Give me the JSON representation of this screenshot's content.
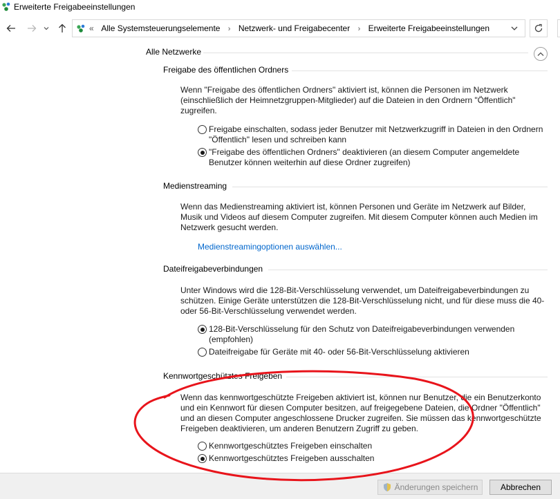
{
  "window": {
    "title": "Erweiterte Freigabeeinstellungen"
  },
  "nav": {
    "back_icon": "arrow-left",
    "forward_icon": "arrow-right",
    "recent_icon": "chevron-down",
    "up_icon": "arrow-up",
    "refresh_icon": "refresh"
  },
  "address": {
    "overflow": "«",
    "crumbs": [
      "Alle Systemsteuerungselemente",
      "Netzwerk- und Freigabecenter",
      "Erweiterte Freigabeeinstellungen"
    ],
    "separator": "›"
  },
  "group": {
    "title": "Alle Netzwerke"
  },
  "sections": {
    "public_folder": {
      "title": "Freigabe des öffentlichen Ordners",
      "description": "Wenn \"Freigabe des öffentlichen Ordners\" aktiviert ist, können die Personen im Netzwerk (einschließlich der Heimnetzgruppen-Mitglieder) auf die Dateien in den Ordnern \"Öffentlich\" zugreifen.",
      "options": [
        {
          "label": "Freigabe einschalten, sodass jeder Benutzer mit Netzwerkzugriff in Dateien in den Ordnern \"Öffentlich\" lesen und schreiben kann",
          "checked": false
        },
        {
          "label": "\"Freigabe des öffentlichen Ordners\" deaktivieren (an diesem Computer angemeldete Benutzer können weiterhin auf diese Ordner zugreifen)",
          "checked": true
        }
      ]
    },
    "media_streaming": {
      "title": "Medienstreaming",
      "description": "Wenn das Medienstreaming aktiviert ist, können Personen und Geräte im Netzwerk auf Bilder, Musik und Videos auf diesem Computer zugreifen. Mit diesem Computer können auch Medien im Netzwerk gesucht werden.",
      "link": "Medienstreamingoptionen auswählen..."
    },
    "file_sharing": {
      "title": "Dateifreigabeverbindungen",
      "description": "Unter Windows wird die 128-Bit-Verschlüsselung verwendet, um Dateifreigabeverbindungen zu schützen. Einige Geräte unterstützen die 128-Bit-Verschlüsselung nicht, und für diese muss die 40- oder 56-Bit-Verschlüsselung verwendet werden.",
      "options": [
        {
          "label": "128-Bit-Verschlüsselung für den Schutz von Dateifreigabeverbindungen verwenden (empfohlen)",
          "checked": true
        },
        {
          "label": "Dateifreigabe für Geräte mit 40- oder 56-Bit-Verschlüsselung aktivieren",
          "checked": false
        }
      ]
    },
    "password_sharing": {
      "title": "Kennwortgeschütztes Freigeben",
      "description": "Wenn das kennwortgeschützte Freigeben aktiviert ist, können nur Benutzer, die ein Benutzerkonto und ein Kennwort für diesen Computer besitzen, auf freigegebene Dateien, die Ordner \"Öffentlich\" und an diesen Computer angeschlossene Drucker zugreifen. Sie müssen das kennwortgeschützte Freigeben deaktivieren, um anderen Benutzern Zugriff zu geben.",
      "options": [
        {
          "label": "Kennwortgeschütztes Freigeben einschalten",
          "checked": false
        },
        {
          "label": "Kennwortgeschütztes Freigeben ausschalten",
          "checked": true
        }
      ]
    }
  },
  "footer": {
    "save_label": "Änderungen speichern",
    "cancel_label": "Abbrechen"
  },
  "colors": {
    "annotation": "#e8141b",
    "link": "#0066cc"
  }
}
